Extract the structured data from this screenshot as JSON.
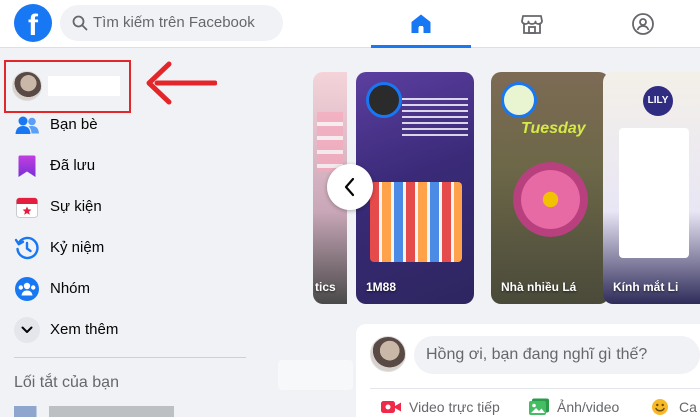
{
  "header": {
    "logo": "f",
    "search_placeholder": "Tìm kiếm trên Facebook",
    "nav": [
      {
        "name": "home",
        "active": true
      },
      {
        "name": "marketplace",
        "active": false
      },
      {
        "name": "groups",
        "active": false
      }
    ],
    "accent": "#1877f2"
  },
  "sidebar": {
    "profile_name": "",
    "items": [
      {
        "label": "Bạn bè",
        "icon": "friends-icon"
      },
      {
        "label": "Đã lưu",
        "icon": "saved-icon"
      },
      {
        "label": "Sự kiện",
        "icon": "events-icon"
      },
      {
        "label": "Kỷ niệm",
        "icon": "memories-icon"
      },
      {
        "label": "Nhóm",
        "icon": "groups-icon"
      },
      {
        "label": "Xem thêm",
        "icon": "chevron-down-icon"
      }
    ],
    "shortcuts_title": "Lối tắt của bạn"
  },
  "annotation": {
    "highlight_color": "#e3262a"
  },
  "stories": [
    {
      "name": "tics"
    },
    {
      "name": "1M88"
    },
    {
      "name": "Nhà nhiều Lá",
      "caption": "Tuesday"
    },
    {
      "name": "Kính mắt Li",
      "logo": "LILY"
    }
  ],
  "composer": {
    "placeholder": "Hồng ơi, bạn đang nghĩ gì thế?",
    "actions": [
      {
        "label": "Video trực tiếp",
        "icon": "live-video-icon",
        "color": "#f02849"
      },
      {
        "label": "Ảnh/video",
        "icon": "photo-icon",
        "color": "#45bd62"
      },
      {
        "label": "Ca",
        "icon": "feeling-icon",
        "color": "#f7b928"
      }
    ]
  }
}
